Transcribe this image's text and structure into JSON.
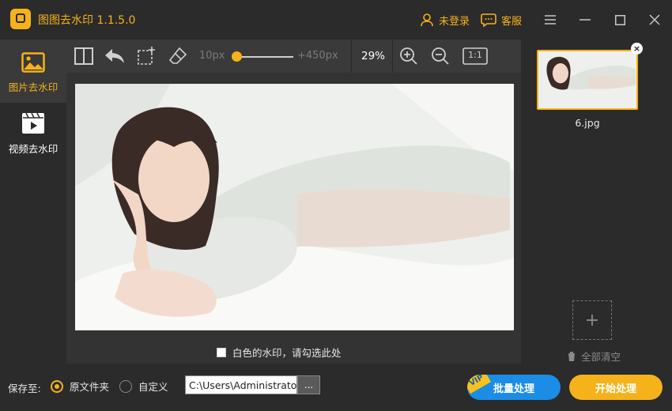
{
  "app": {
    "title": "图图去水印  1.1.5.0",
    "accent": "#f6b21b"
  },
  "header": {
    "login_label": "未登录",
    "service_label": "客服"
  },
  "sidebar": {
    "items": [
      {
        "label": "图片去水印",
        "icon": "image-icon",
        "active": true
      },
      {
        "label": "视频去水印",
        "icon": "video-icon",
        "active": false
      }
    ]
  },
  "toolbar": {
    "brush_min": "10px",
    "brush_max": "+450px",
    "brush_level": 0.0,
    "zoom": "29%",
    "fit_label": "1:1"
  },
  "canvas": {
    "white_watermark_label": "白色的水印，请勾选此处",
    "white_watermark_checked": false
  },
  "files": {
    "items": [
      {
        "name": "6.jpg",
        "selected": true
      }
    ],
    "clear_all_label": "全部清空"
  },
  "bottom": {
    "save_to_label": "保存至:",
    "options": [
      {
        "label": "原文件夹",
        "selected": true
      },
      {
        "label": "自定义",
        "selected": false
      }
    ],
    "path": "C:\\Users\\Administrator",
    "browse_label": "...",
    "vip_badge": "VIP",
    "batch_label": "批量处理",
    "start_label": "开始处理"
  }
}
